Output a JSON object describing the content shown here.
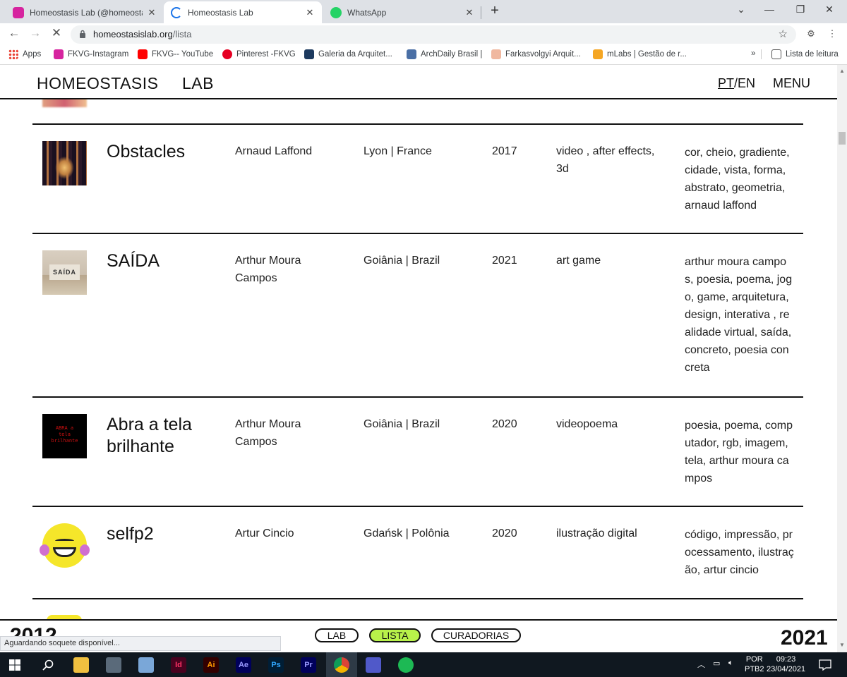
{
  "browser": {
    "tabs": [
      {
        "title": "Homeostasis Lab (@homeostasis",
        "favicon_color": "#d6249f",
        "active": false
      },
      {
        "title": "Homeostasis Lab",
        "favicon_color": "#1a73e8",
        "active": true
      },
      {
        "title": "WhatsApp",
        "favicon_color": "#25d366",
        "active": false
      }
    ],
    "url_host": "homeostasislab.org",
    "url_path": "/lista",
    "bookmarks": [
      {
        "label": "Apps",
        "color": "#4285f4"
      },
      {
        "label": "FKVG-Instagram",
        "color": "#d6249f"
      },
      {
        "label": "FKVG-- YouTube",
        "color": "#ff0000"
      },
      {
        "label": "Pinterest -FKVG",
        "color": "#e60023"
      },
      {
        "label": "Galeria da Arquitet...",
        "color": "#1d3a5f"
      },
      {
        "label": "ArchDaily Brasil |",
        "color": "#4a6fa5"
      },
      {
        "label": "Farkasvolgyi Arquit...",
        "color": "#f0b8a0"
      },
      {
        "label": "mLabs | Gestão de r...",
        "color": "#f5a623"
      }
    ],
    "reading_list": "Lista de leitura",
    "status_text": "Aguardando soquete disponível..."
  },
  "site": {
    "logo": "HOMEOSTASIS",
    "logo_lab": "LAB",
    "lang_pt": "PT",
    "lang_sep": "/",
    "lang_en": "EN",
    "menu": "MENU"
  },
  "rows": [
    {
      "title": "Obstacles",
      "author": "Arnaud Laffond",
      "place": "Lyon | France",
      "year": "2017",
      "media": "video , after effects, 3d",
      "tags": "cor, cheio, gradiente, cidade, vista, forma, abstrato, geometria, arnaud laffond"
    },
    {
      "title": "SAÍDA",
      "thumb_text": "SAÍDA",
      "author": "Arthur Moura Campos",
      "place": "Goiânia | Brazil",
      "year": "2021",
      "media": "art game",
      "tags": "arthur moura campos, poesia, poema, jogo, game, arquitetura, design, interativa , realidade virtual, saída, concreto, poesia concreta"
    },
    {
      "title": "Abra a tela brilhante",
      "thumb_text": "ABRA a tela brilhante",
      "author": "Arthur Moura Campos",
      "place": "Goiânia | Brazil",
      "year": "2020",
      "media": "videopoema",
      "tags": "poesia, poema, computador, rgb, imagem, tela, arthur moura campos"
    },
    {
      "title": "selfp2",
      "author": "Artur Cincio",
      "place": "Gdańsk | Polônia",
      "year": "2020",
      "media": "ilustração digital",
      "tags": "código, impressão, processamento, ilustração, artur cincio"
    }
  ],
  "footer": {
    "year_left": "2012",
    "year_right": "2021",
    "nav": {
      "lab": "LAB",
      "lista": "LISTA",
      "curadorias": "CURADORIAS"
    },
    "lista_color": "#b8f24a"
  },
  "taskbar": {
    "apps": [
      {
        "name": "file-explorer",
        "label": "",
        "color": "#f0c040"
      },
      {
        "name": "calculator",
        "label": "",
        "color": "#5a6a7a"
      },
      {
        "name": "notes",
        "label": "",
        "color": "#7aa7d8"
      },
      {
        "name": "indesign",
        "label": "Id",
        "color": "#49021f"
      },
      {
        "name": "illustrator",
        "label": "Ai",
        "color": "#330000"
      },
      {
        "name": "after-effects",
        "label": "Ae",
        "color": "#00005b"
      },
      {
        "name": "photoshop",
        "label": "Ps",
        "color": "#001e36"
      },
      {
        "name": "premiere",
        "label": "Pr",
        "color": "#00005b"
      },
      {
        "name": "chrome",
        "label": "",
        "color": "#db4437"
      },
      {
        "name": "teams",
        "label": "",
        "color": "#5059c9"
      },
      {
        "name": "spotify",
        "label": "",
        "color": "#1db954"
      }
    ],
    "lang_line1": "POR",
    "lang_line2": "PTB2",
    "time": "09:23",
    "date": "23/04/2021"
  }
}
